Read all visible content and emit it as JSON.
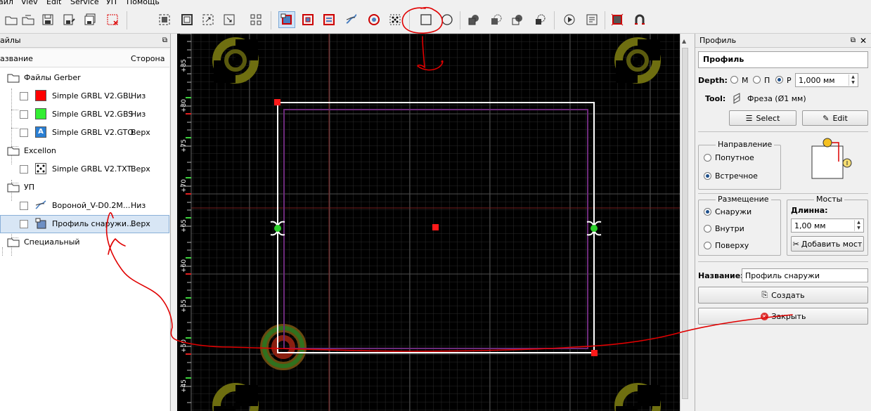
{
  "menu": [
    "айл",
    "Viev",
    "Edit",
    "Service",
    "УП",
    "Помощь"
  ],
  "left_panel": {
    "title": "айлы",
    "col_name": "азвание",
    "col_side": "Сторона",
    "rows": [
      {
        "label": "Файлы Gerber",
        "side": ""
      },
      {
        "label": "Simple GRBL V2.GBL",
        "side": "Низ",
        "color": "#ff0000"
      },
      {
        "label": "Simple GRBL V2.GBS",
        "side": "Низ",
        "color": "#33ee33"
      },
      {
        "label": "Simple GRBL V2.GTO",
        "side": "Верх",
        "color": "#2a7fd4",
        "glyph": "A"
      },
      {
        "label": "Excellon",
        "side": ""
      },
      {
        "label": "Simple GRBL V2.TXT",
        "side": "Верх"
      },
      {
        "label": "УП",
        "side": ""
      },
      {
        "label": "Вороной_V-D0.2M...",
        "side": "Низ"
      },
      {
        "label": "Профиль снаружи...",
        "side": "Верх"
      },
      {
        "label": "Специальный",
        "side": ""
      }
    ]
  },
  "canvas": {
    "ruler_labels": [
      "+85",
      "+80",
      "+75",
      "+70",
      "+65",
      "+60",
      "+55",
      "+50",
      "+45"
    ]
  },
  "right_panel": {
    "title": "Профиль",
    "box_title": "Профиль",
    "depth_label": "Depth:",
    "depth_options": [
      "М",
      "П",
      "Р"
    ],
    "depth_value": "1,000 мм",
    "tool_label": "Tool:",
    "tool_value": "Фреза (Ø1 мм)",
    "select_btn": "Select",
    "edit_btn": "Edit",
    "direction": {
      "title": "Направление",
      "options": [
        "Попутное",
        "Встречное"
      ]
    },
    "placement": {
      "title": "Размещение",
      "options": [
        "Снаружи",
        "Внутри",
        "Поверху"
      ]
    },
    "bridges": {
      "title": "Мосты",
      "length_label": "Длинна:",
      "length_value": "1,00 мм",
      "add_btn": "Добавить мост"
    },
    "name_label": "Название:",
    "name_value": "Профиль снаружи",
    "create_btn": "Создать",
    "close_btn": "Закрыть"
  },
  "colors": {
    "accent": "#1e4f8a",
    "annotation": "#e00000"
  }
}
